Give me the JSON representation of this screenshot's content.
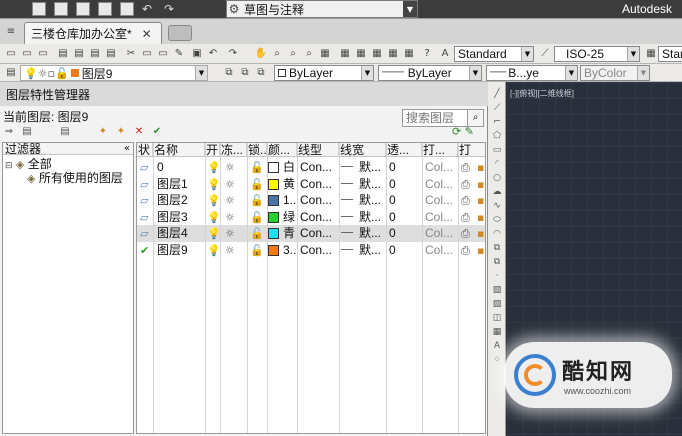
{
  "titlebar": {
    "workspace": "草图与注释",
    "brand": "Autodesk"
  },
  "tabs": {
    "document": "三楼仓库加办公室*",
    "close": "✕"
  },
  "toolbar1": {
    "text_style": "Standard",
    "dim_style": "ISO-25",
    "table_style": "Stand"
  },
  "toolbar2": {
    "layer": "图层9",
    "color": "ByLayer",
    "linetype": "ByLayer",
    "lineweight": "B...ye",
    "plotstyle": "ByColor",
    "layer_color": "#f07a1a",
    "color_swatch": "#ffffff"
  },
  "panel": {
    "title": "图层特性管理器",
    "current_layer": "当前图层: 图层9",
    "search_placeholder": "搜索图层",
    "filter_header": "过滤器",
    "collapse": "«",
    "filters": [
      "全部",
      "所有使用的图层"
    ],
    "columns": [
      "状",
      "名称",
      "开",
      "冻...",
      "锁...",
      "颜...",
      "线型",
      "线宽",
      "透...",
      "打...",
      "打"
    ]
  },
  "layers": [
    {
      "name": "0",
      "color_name": "白",
      "color": "#ffffff",
      "linetype": "Con...",
      "lineweight": "默...",
      "transparency": "0",
      "plotstyle": "Col...",
      "current": false,
      "selected": false
    },
    {
      "name": "图层1",
      "color_name": "黄",
      "color": "#ffff00",
      "linetype": "Con...",
      "lineweight": "默...",
      "transparency": "0",
      "plotstyle": "Col...",
      "current": false,
      "selected": false
    },
    {
      "name": "图层2",
      "color_name": "1...",
      "color": "#4a72a8",
      "linetype": "Con...",
      "lineweight": "默...",
      "transparency": "0",
      "plotstyle": "Col...",
      "current": false,
      "selected": false
    },
    {
      "name": "图层3",
      "color_name": "绿",
      "color": "#2ad02a",
      "linetype": "Con...",
      "lineweight": "默...",
      "transparency": "0",
      "plotstyle": "Col...",
      "current": false,
      "selected": false
    },
    {
      "name": "图层4",
      "color_name": "青",
      "color": "#20e0f0",
      "linetype": "Con...",
      "lineweight": "默...",
      "transparency": "0",
      "plotstyle": "Col...",
      "current": false,
      "selected": true
    },
    {
      "name": "图层9",
      "color_name": "3...",
      "color": "#f07a1a",
      "linetype": "Con...",
      "lineweight": "默...",
      "transparency": "0",
      "plotstyle": "Col...",
      "current": true,
      "selected": false
    }
  ],
  "viewport": {
    "label": "[-][俯视][二维线框]"
  },
  "watermark": {
    "title": "酷知网",
    "url": "www.coozhi.com"
  }
}
